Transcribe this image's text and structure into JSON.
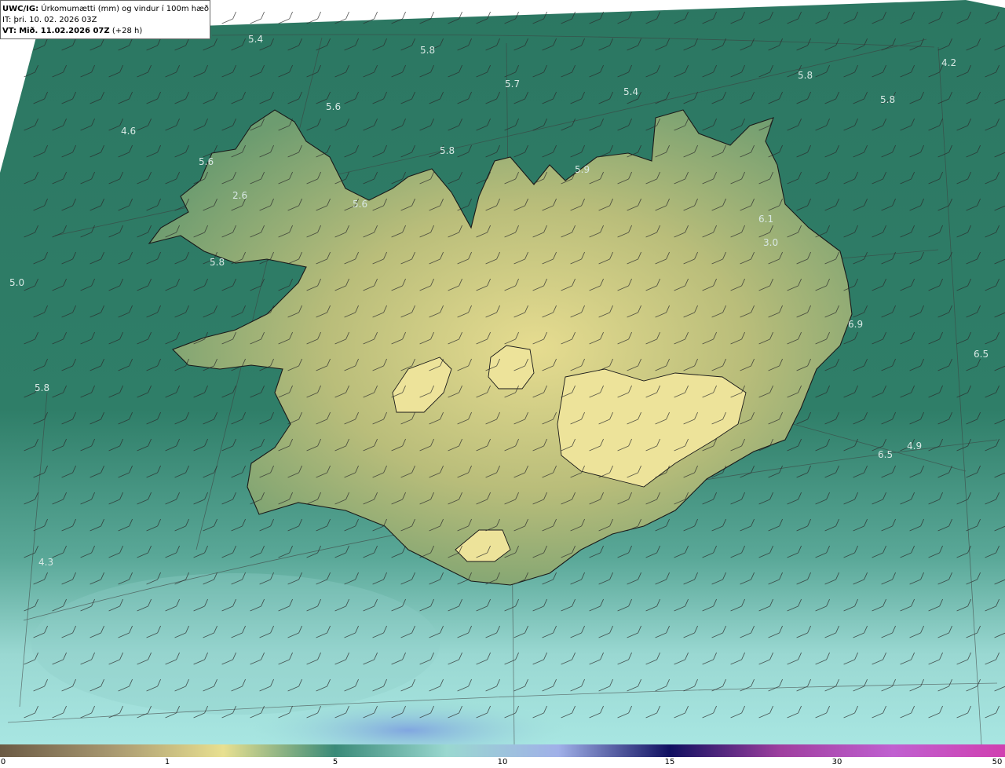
{
  "title": {
    "model": "UWC/IG:",
    "description": "Úrkomumætti (mm) og vindur í 100m hæð",
    "initial_time": "IT: þri. 10. 02. 2026 03Z",
    "valid_prefix": "VT:",
    "valid_time": "Mið. 11.02.2026 07Z",
    "lead_time": "(+28 h)"
  },
  "values": [
    "5.4",
    "5.8",
    "5.7",
    "5.4",
    "5.8",
    "4.2",
    "5.8",
    "5.6",
    "4.6",
    "5.8",
    "5.6",
    "5.9",
    "2.6",
    "5.6",
    "6.1",
    "3.0",
    "5.8",
    "5.0",
    "6.9",
    "6.5",
    "5.8",
    "6.5",
    "4.9",
    "4.3"
  ],
  "colorbar": {
    "unit_hint": "mm",
    "ticks": [
      "0",
      "1",
      "5",
      "10",
      "15",
      "30",
      "50"
    ],
    "colors": [
      "#6b5a44",
      "#a89870",
      "#e8e090",
      "#3a8a78",
      "#9ad8d0",
      "#a0b0e8",
      "#101060",
      "#a040a0",
      "#c060d0",
      "#d040b0"
    ]
  },
  "colors": {
    "sea_base": "#2f7a64",
    "land_base": "#c9c486",
    "low_sea": "#9ddbd6",
    "coast": "#1a1a1a"
  }
}
